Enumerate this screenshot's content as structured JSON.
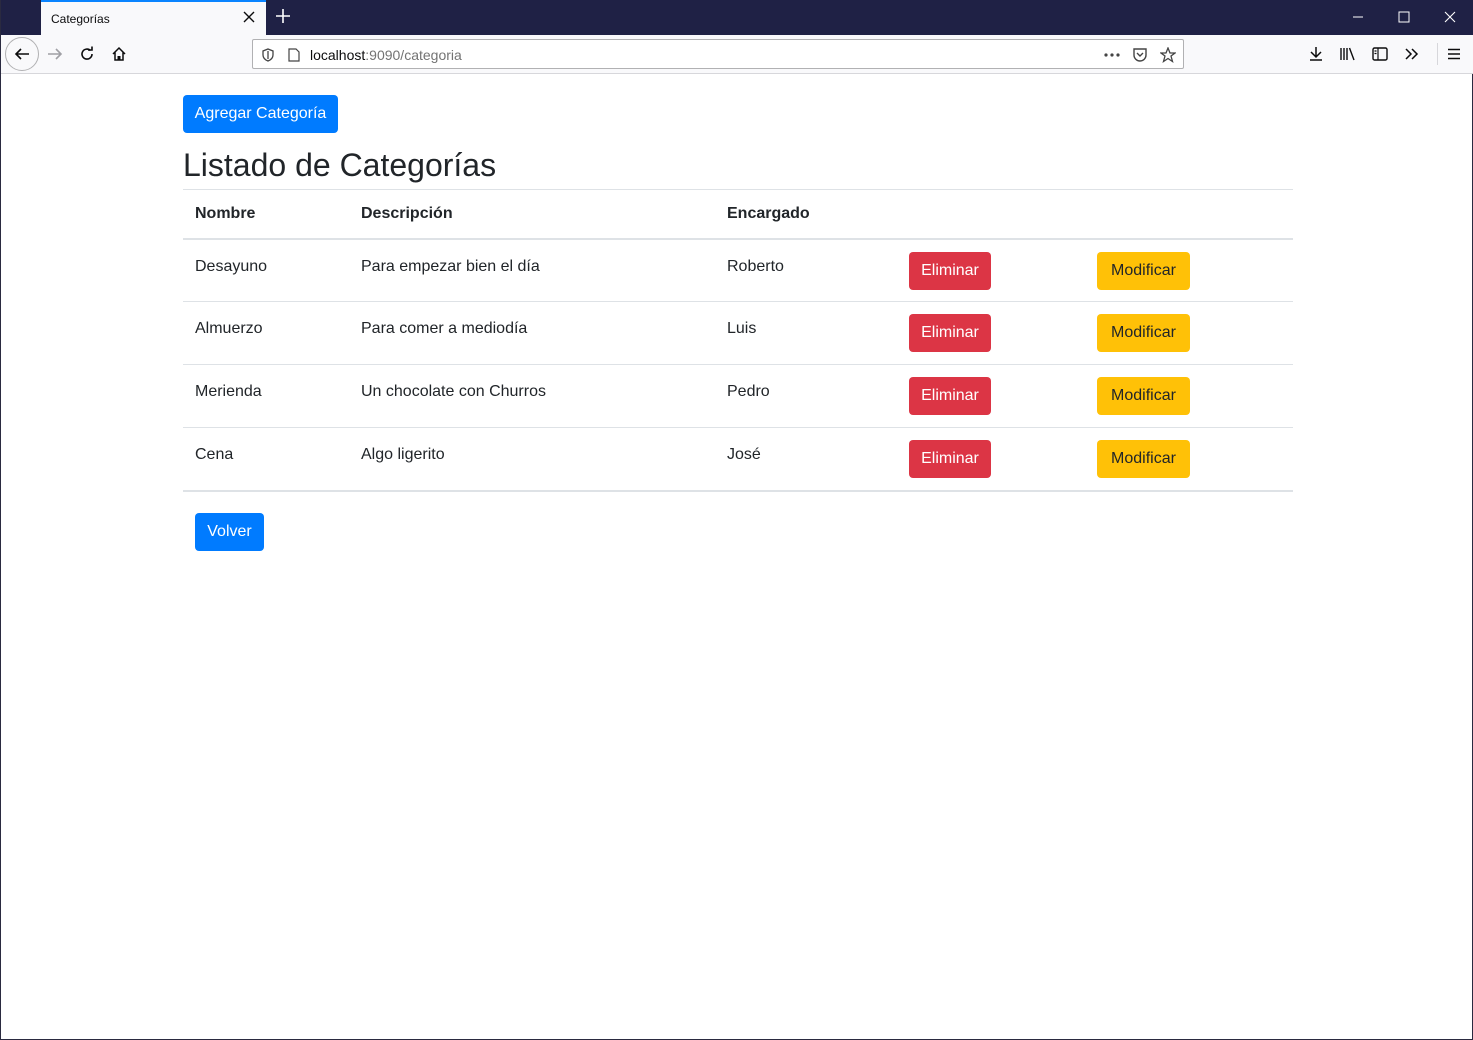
{
  "browser": {
    "tab_title": "Categorías",
    "url_host": "localhost",
    "url_rest": ":9090/categoria"
  },
  "page": {
    "add_button": "Agregar Categoría",
    "title": "Listado de Categorías",
    "back_button": "Volver",
    "columns": [
      "Nombre",
      "Descripción",
      "Encargado"
    ],
    "delete_label": "Eliminar",
    "modify_label": "Modificar",
    "rows": [
      {
        "nombre": "Desayuno",
        "descripcion": "Para empezar bien el día",
        "encargado": "Roberto"
      },
      {
        "nombre": "Almuerzo",
        "descripcion": "Para comer a mediodía",
        "encargado": "Luis"
      },
      {
        "nombre": "Merienda",
        "descripcion": "Un chocolate con Churros",
        "encargado": "Pedro"
      },
      {
        "nombre": "Cena",
        "descripcion": "Algo ligerito",
        "encargado": "José"
      }
    ]
  },
  "colors": {
    "primary": "#007bff",
    "danger": "#dc3545",
    "warning": "#ffc107",
    "titlebar": "#1f2145"
  }
}
